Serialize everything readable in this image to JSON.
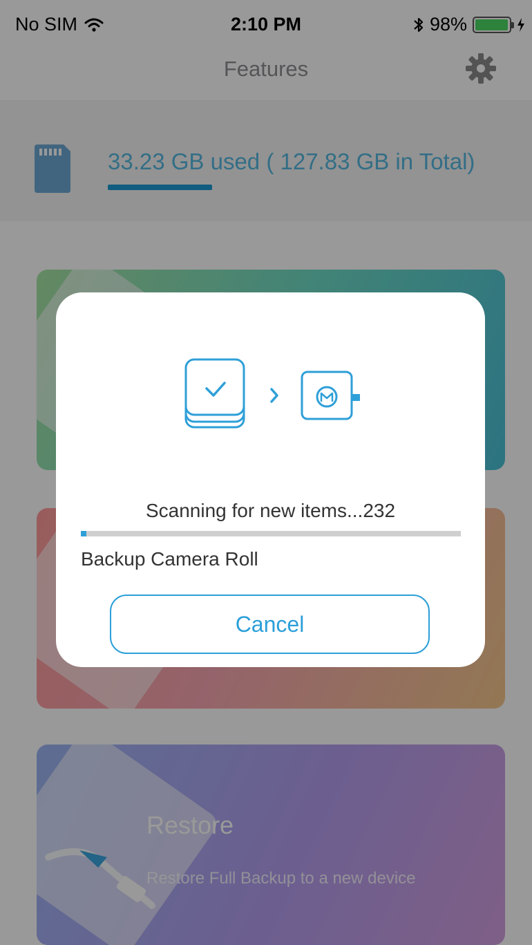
{
  "status_bar": {
    "carrier": "No SIM",
    "time": "2:10 PM",
    "battery_percent": "98%",
    "battery_level": 0.98,
    "icons": [
      "wifi-icon",
      "bluetooth-icon",
      "battery-icon",
      "charging-icon"
    ]
  },
  "nav": {
    "title": "Features",
    "settings_icon": "gear-icon"
  },
  "storage": {
    "icon": "sd-card-icon",
    "text": "33.23 GB used ( 127.83 GB in Total)",
    "used_fraction": 0.26
  },
  "cards": [
    {
      "id": "card-backup",
      "title": "",
      "subtitle": ""
    },
    {
      "id": "card-second",
      "title": "",
      "subtitle": ""
    },
    {
      "id": "card-restore",
      "title": "Restore",
      "subtitle": "Restore Full Backup to a new device"
    }
  ],
  "dialog": {
    "icons": [
      "photo-stack-check-icon",
      "chevron-right-icon",
      "drive-device-icon"
    ],
    "scanning_text": "Scanning for new items...232",
    "progress_fraction": 0.015,
    "task_label": "Backup Camera Roll",
    "cancel_label": "Cancel"
  },
  "colors": {
    "accent": "#2b9fd9",
    "storage_bar": "#1e9ad6",
    "battery_green": "#4cd964"
  }
}
